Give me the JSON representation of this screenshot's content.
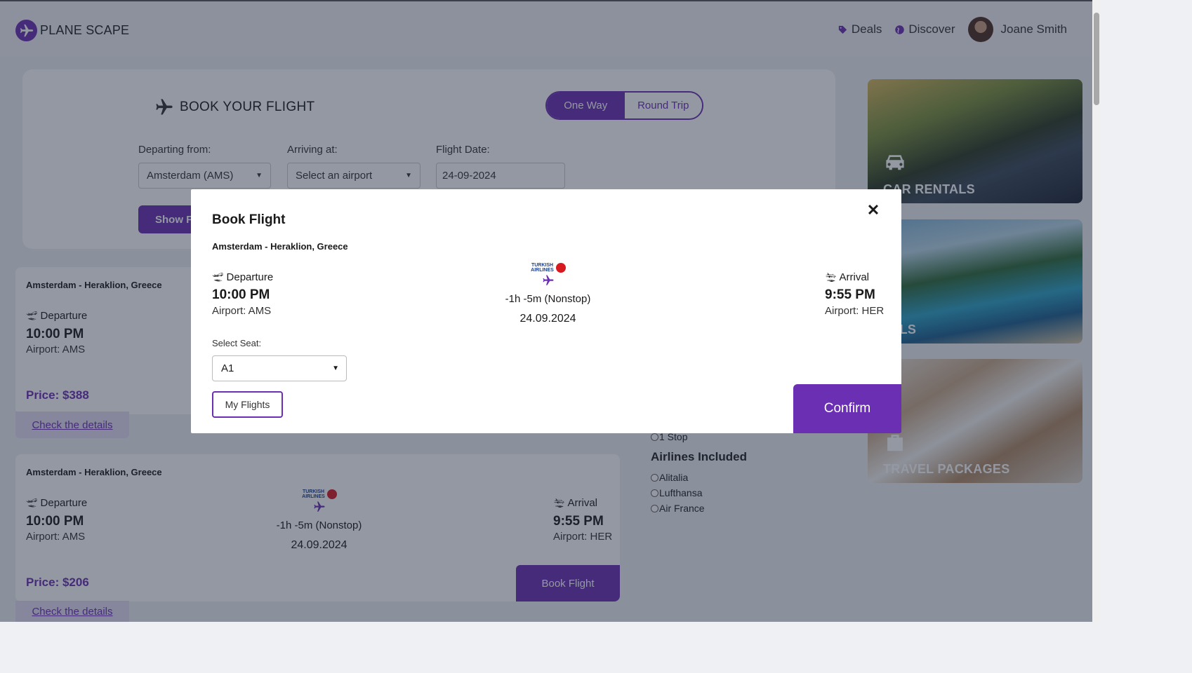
{
  "header": {
    "brand": "PLANE SCAPE",
    "nav": [
      {
        "label": "Deals",
        "icon": "tag-icon"
      },
      {
        "label": "Discover",
        "icon": "globe-icon"
      }
    ],
    "user": {
      "name": "Joane Smith"
    }
  },
  "booking": {
    "title": "BOOK YOUR FLIGHT",
    "trip_types": [
      "One Way",
      "Round Trip"
    ],
    "selected_trip_type": "One Way",
    "departing_label": "Departing from:",
    "departing_value": "Amsterdam (AMS)",
    "arriving_label": "Arriving at:",
    "arriving_value": "Select an airport",
    "date_label": "Flight Date:",
    "date_value": "24-09-2024",
    "show_button": "Show F"
  },
  "flights": [
    {
      "route": "Amsterdam - Heraklion, Greece",
      "departure_label": "Departure",
      "departure_time": "10:00 PM",
      "departure_airport": "Airport: AMS",
      "price": "Price: $388",
      "details": "Check the details"
    },
    {
      "route": "Amsterdam - Heraklion, Greece",
      "departure_label": "Departure",
      "departure_time": "10:00 PM",
      "departure_airport": "Airport: AMS",
      "airline": "TURKISH AIRLINES",
      "duration": "-1h -5m (Nonstop)",
      "date": "24.09.2024",
      "arrival_label": "Arrival",
      "arrival_time": "9:55 PM",
      "arrival_airport": "Airport: HER",
      "price": "Price: $206",
      "book_button": "Book Flight",
      "details": "Check the details"
    }
  ],
  "filters": {
    "stops": [
      "1 Stop"
    ],
    "airlines_title": "Airlines Included",
    "airlines": [
      "Alitalia",
      "Lufthansa",
      "Air France"
    ]
  },
  "tiles": [
    {
      "label": "CAR RENTALS",
      "icon": "car-icon"
    },
    {
      "label": "TELS",
      "icon": "hotel-icon"
    },
    {
      "label": "TRAVEL PACKAGES",
      "icon": "suitcase-icon"
    }
  ],
  "modal": {
    "title": "Book Flight",
    "route": "Amsterdam - Heraklion, Greece",
    "departure_label": "Departure",
    "departure_time": "10:00 PM",
    "departure_airport": "Airport: AMS",
    "airline": "TURKISH AIRLINES",
    "duration": "-1h -5m (Nonstop)",
    "date": "24.09.2024",
    "arrival_label": "Arrival",
    "arrival_time": "9:55 PM",
    "arrival_airport": "Airport: HER",
    "seat_label": "Select Seat:",
    "seat_value": "A1",
    "my_flights": "My Flights",
    "confirm": "Confirm"
  },
  "colors": {
    "accent": "#6b2fb3",
    "overlay": "rgba(30,40,60,0.48)"
  }
}
